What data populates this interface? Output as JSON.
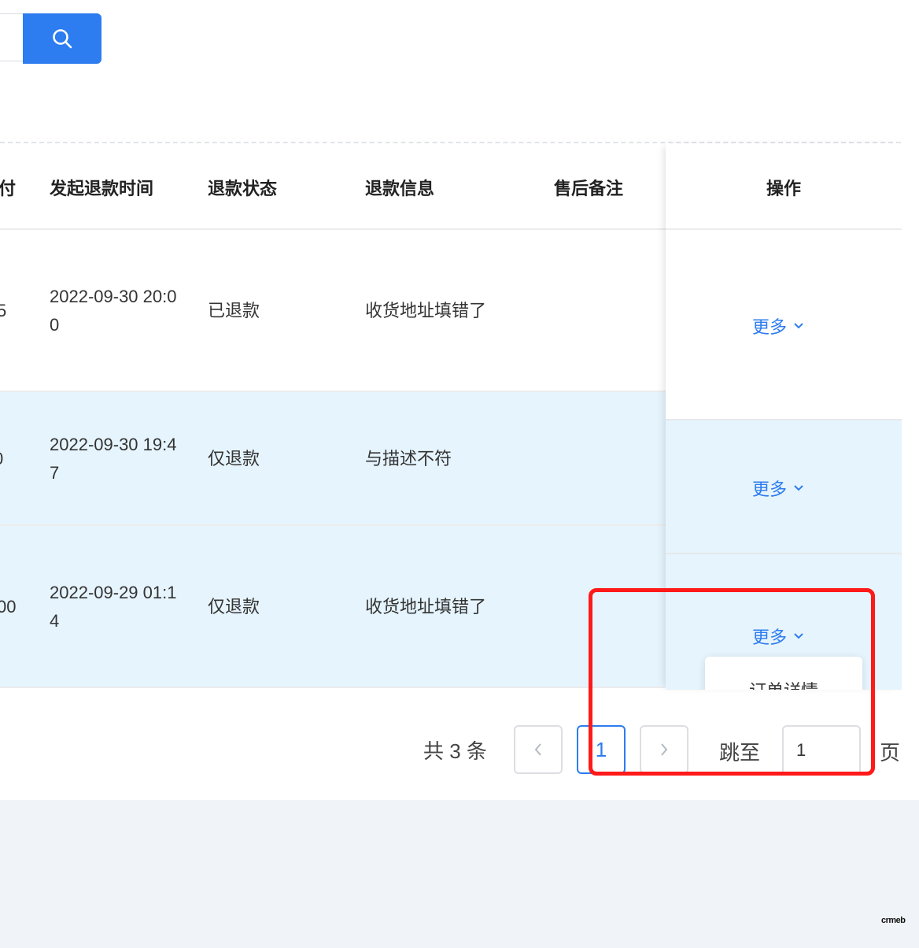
{
  "table": {
    "headers": {
      "pay_partial": "付",
      "refund_time": "发起退款时间",
      "refund_status": "退款状态",
      "refund_info": "退款信息",
      "after_sale_note": "售后备注",
      "operation": "操作"
    },
    "rows": [
      {
        "pay_partial": "5",
        "time_line1": "2022-09-30 20:0",
        "time_line2": "0",
        "status": "已退款",
        "info": "收货地址填错了",
        "note": "",
        "action": "更多"
      },
      {
        "pay_partial": "0",
        "time_line1": "2022-09-30 19:4",
        "time_line2": "7",
        "status": "仅退款",
        "info": "与描述不符",
        "note": "",
        "action": "更多"
      },
      {
        "pay_partial": "00",
        "time_line1": "2022-09-29 01:1",
        "time_line2": "4",
        "status": "仅退款",
        "info": "收货地址填错了",
        "note": "",
        "action": "更多"
      }
    ]
  },
  "dropdown": {
    "item_partial": "订单详情"
  },
  "pagination": {
    "total": "共 3 条",
    "current_page": "1",
    "jump_label": "跳至",
    "jump_value": "1",
    "page_suffix": "页"
  },
  "colors": {
    "primary": "#2d7cf0",
    "row_highlight": "#e6f4fd",
    "annotation": "#ff1a1a"
  },
  "icons": {
    "search": "search-icon",
    "prev": "chevron-left-icon",
    "next": "chevron-right-icon",
    "more": "chevron-down-icon"
  },
  "brand": {
    "logo_text": "crmeb"
  }
}
